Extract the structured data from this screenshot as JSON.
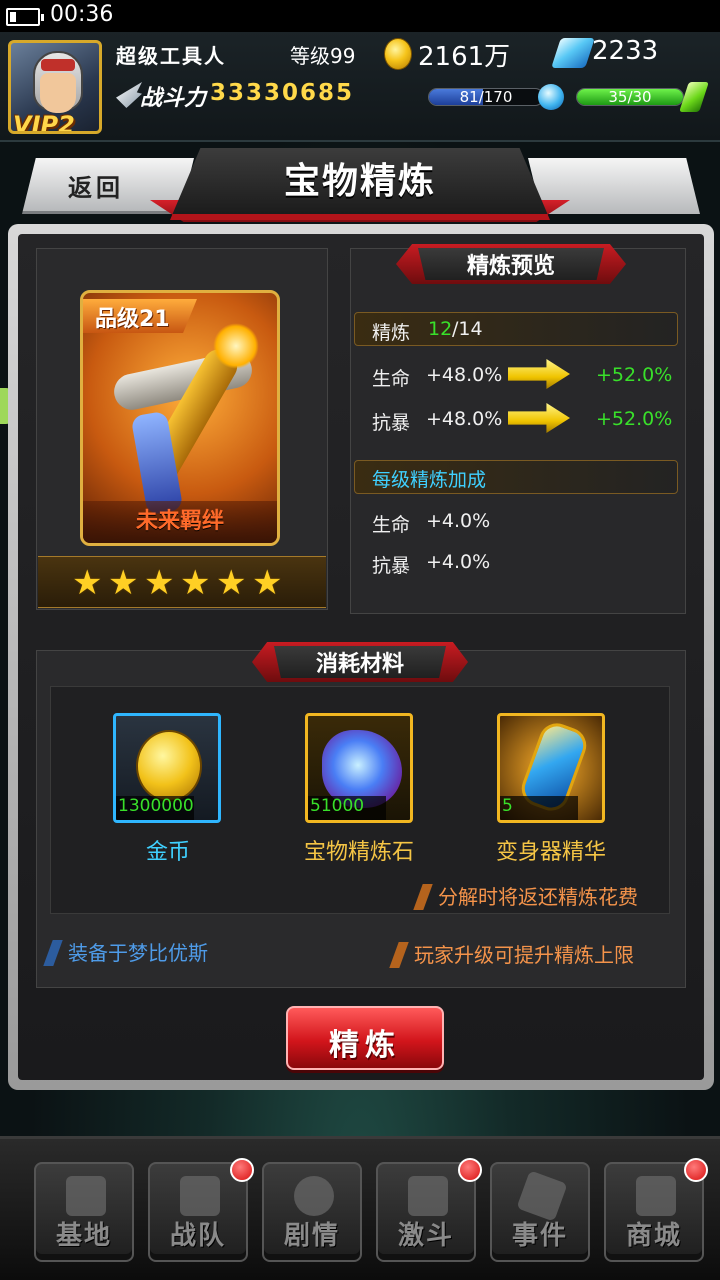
{
  "status": {
    "time": "00:36"
  },
  "player": {
    "name": "超级工具人",
    "level": "等级99",
    "vip": "VIP2",
    "gold": "2161万",
    "gems": "2233",
    "power_label": "战斗力",
    "power_value": "33330685",
    "energy": "81/170",
    "energy_fraction": 0.476,
    "stamina": "35/30",
    "stamina_fraction": 1.0
  },
  "header": {
    "back_label": "返回",
    "title": "宝物精炼"
  },
  "item": {
    "grade": "品级21",
    "name": "未来羁绊",
    "stars": 6
  },
  "preview": {
    "title": "精炼预览",
    "refine_label": "精炼",
    "refine_current": "12",
    "refine_max": "/14",
    "stats": [
      {
        "name": "生命",
        "current": "+48.0%",
        "next": "+52.0%"
      },
      {
        "name": "抗暴",
        "current": "+48.0%",
        "next": "+52.0%"
      }
    ],
    "bonus_title": "每级精炼加成",
    "bonus": [
      {
        "name": "生命",
        "value": "+4.0%"
      },
      {
        "name": "抗暴",
        "value": "+4.0%"
      }
    ]
  },
  "materials": {
    "title": "消耗材料",
    "items": [
      {
        "name": "金币",
        "count": "1300000",
        "icon": "gold-coin-icon"
      },
      {
        "name": "宝物精炼石",
        "count": "51000",
        "icon": "refine-stone-icon"
      },
      {
        "name": "变身器精华",
        "count": "5",
        "icon": "transformer-essence-icon"
      }
    ],
    "note": "分解时将返还精炼花费"
  },
  "footer_notes": {
    "equipped": "装备于梦比优斯",
    "limit": "玩家升级可提升精炼上限"
  },
  "action": {
    "refine_button": "精炼"
  },
  "nav": [
    {
      "label": "基地",
      "badge": false
    },
    {
      "label": "战队",
      "badge": true
    },
    {
      "label": "剧情",
      "badge": false
    },
    {
      "label": "激斗",
      "badge": true
    },
    {
      "label": "事件",
      "badge": false
    },
    {
      "label": "商城",
      "badge": true
    }
  ],
  "colors": {
    "accent_red": "#d2151b",
    "positive_green": "#39e02a",
    "gold": "#ffd94a"
  }
}
